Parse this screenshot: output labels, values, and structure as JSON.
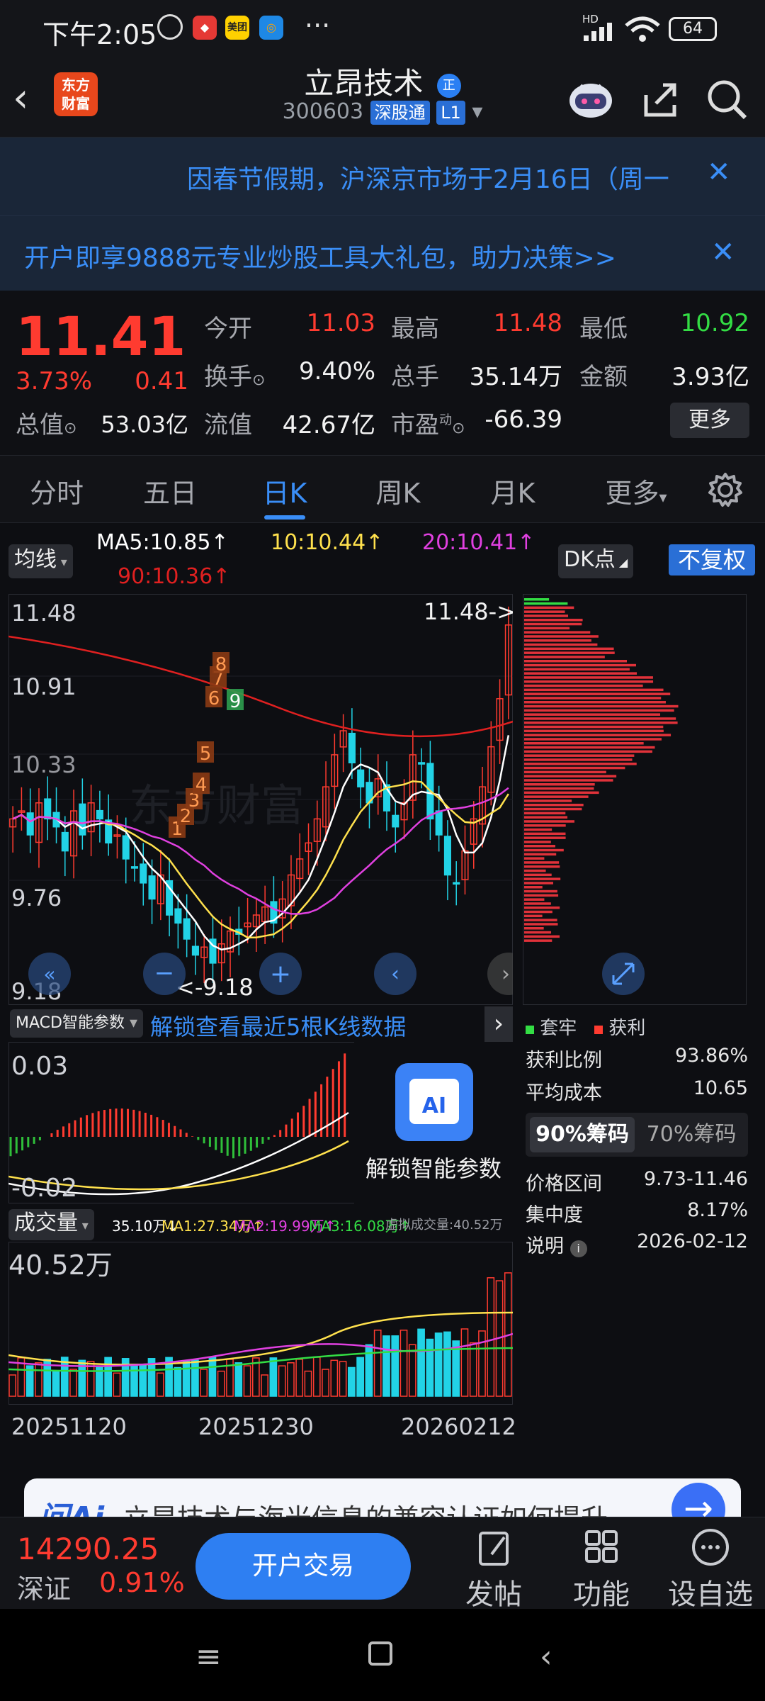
{
  "status": {
    "time": "下午2:05",
    "icons": [
      "alarm-icon",
      "app-icon-red",
      "meituan-icon",
      "app-icon-blue"
    ],
    "meituan_label": "美团",
    "more": "···",
    "hd_label": "HD",
    "battery": "64"
  },
  "header": {
    "back": "‹",
    "logo_line1": "东方",
    "logo_line2": "财富",
    "name": "立昂技术",
    "name_badge": "正",
    "code": "300603",
    "tag1": "深股通",
    "tag2": "L1",
    "dropdown": "▾"
  },
  "banners": {
    "notice": "因春节假期，沪深京市场于2月16日（周一",
    "promo": "开户即享9888元专业炒股工具大礼包，助力决策>>",
    "close": "✕"
  },
  "quote": {
    "price": "11.41",
    "change_pct": "3.73%",
    "change": "0.41",
    "rows": [
      [
        {
          "label": "今开",
          "value": "11.03",
          "color": "red"
        },
        {
          "label": "最高",
          "value": "11.48",
          "color": "red"
        },
        {
          "label": "最低",
          "value": "10.92",
          "color": "green"
        }
      ],
      [
        {
          "label": "换手",
          "value": "9.40%",
          "color": "white"
        },
        {
          "label": "总手",
          "value": "35.14万",
          "color": "white"
        },
        {
          "label": "金额",
          "value": "3.93亿",
          "color": "white"
        }
      ]
    ],
    "total_cap_label": "总值",
    "total_cap": "53.03亿",
    "float_cap_label": "流值",
    "float_cap": "42.67亿",
    "pe_label": "市盈",
    "pe_sup": "动",
    "pe": "-66.39",
    "more": "更多"
  },
  "tabs": [
    "分时",
    "五日",
    "日K",
    "周K",
    "月K",
    "更多"
  ],
  "tabs_active": 2,
  "ma": {
    "selector": "均线",
    "ma5": "MA5:10.85↑",
    "ma10": "10:10.44↑",
    "ma20": "20:10.41↑",
    "ma90": "90:10.36↑",
    "dk": "DK点",
    "fq": "不复权"
  },
  "kline": {
    "y_high": "11.48",
    "y_mid1": "10.91",
    "y_mid2": "10.33",
    "y_low1": "9.76",
    "y_low2": "9.18",
    "max_label": "11.48->",
    "min_label": "<-9.18",
    "seq_labels": [
      "1",
      "2",
      "3",
      "4",
      "5",
      "6",
      "7",
      "8",
      "9"
    ],
    "watermark": "东方财富"
  },
  "chip": {
    "legend_trap": "套牢",
    "legend_profit": "获利",
    "profit_ratio_label": "获利比例",
    "profit_ratio": "93.86%",
    "avg_cost_label": "平均成本",
    "avg_cost": "10.65",
    "tab90": "90%筹码",
    "tab70": "70%筹码",
    "range_label": "价格区间",
    "range": "9.73-11.46",
    "concentration_label": "集中度",
    "concentration": "8.17%",
    "note_label": "说明",
    "date": "2026-02-12"
  },
  "macd": {
    "selector": "MACD智能参数",
    "unlock": "解锁查看最近5根K线数据",
    "y_top": "0.03",
    "y_bottom": "-0.02",
    "ai_label": "AI",
    "unlock_params": "解锁智能参数"
  },
  "volume": {
    "selector": "成交量",
    "vol": "35.10万↓",
    "ma1": "MA1:27.34万↑",
    "ma2": "MA2:19.99万↑",
    "ma3": "MA3:16.08万↑",
    "virtual": "虚拟成交量:40.52万",
    "y_top": "40.52万"
  },
  "dates": [
    "20251120",
    "20251230",
    "20260212"
  ],
  "ask": {
    "logo": "问Ai",
    "text": "立昂技术与海光信息的兼容认证如何提升"
  },
  "bottom": {
    "index_value": "14290.25",
    "index_name": "深证",
    "index_pct": "0.91%",
    "trade": "开户交易",
    "post": "发帖",
    "func": "功能",
    "watch": "设自选"
  },
  "colors": {
    "up": "#ff3b30",
    "down": "#22d3e6",
    "accent": "#3a8ef7",
    "ma5": "#ffffff",
    "ma10": "#ffe14d",
    "ma20": "#e040e0",
    "ma90": "#e02020"
  }
}
